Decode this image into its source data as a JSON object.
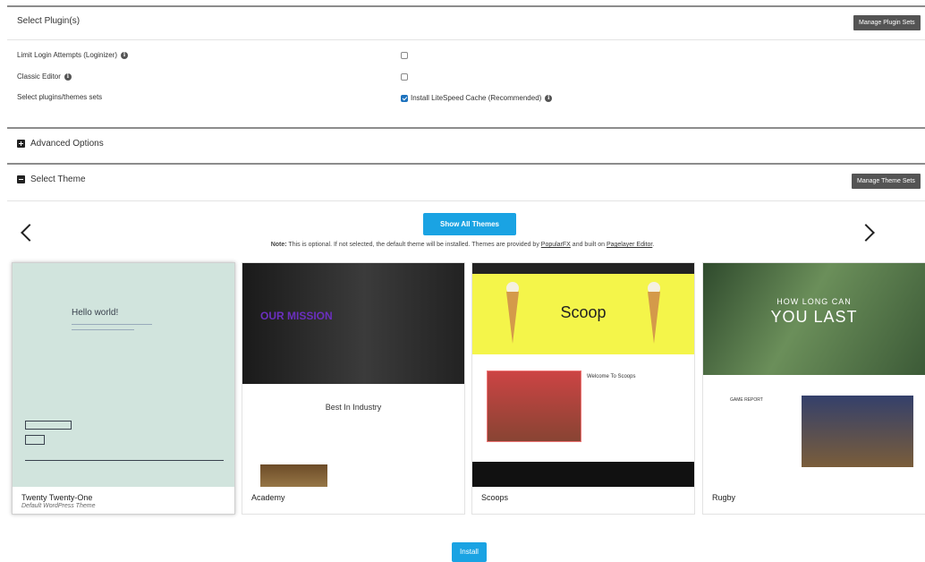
{
  "plugins_section": {
    "title": "Select Plugin(s)",
    "manage_button": "Manage Plugin Sets",
    "rows": [
      {
        "label": "Limit Login Attempts (Loginizer)",
        "has_info": true,
        "checked": false
      },
      {
        "label": "Classic Editor",
        "has_info": true,
        "checked": false
      },
      {
        "label": "Select plugins/themes sets",
        "has_info": false,
        "checked": true,
        "option_label": "Install LiteSpeed Cache (Recommended)"
      }
    ]
  },
  "advanced_section": {
    "title": "Advanced Options"
  },
  "theme_section": {
    "title": "Select Theme",
    "manage_button": "Manage Theme Sets",
    "show_all_button": "Show All Themes",
    "note_bold": "Note:",
    "note_text_1": " This is optional. If not selected, the default theme will be installed. Themes are provided by ",
    "note_link_1": "PopularFX",
    "note_text_2": " and built on ",
    "note_link_2": "Pagelayer Editor",
    "note_text_3": ".",
    "themes": [
      {
        "name": "Twenty Twenty-One",
        "subtitle": "Default WordPress Theme",
        "selected": true,
        "preview_heading": "Hello world!"
      },
      {
        "name": "Academy",
        "subtitle": "",
        "selected": false,
        "preview_heading": "OUR MISSION",
        "preview_sub": "Best In Industry"
      },
      {
        "name": "Scoops",
        "subtitle": "",
        "selected": false,
        "preview_heading": "Scoop",
        "preview_sub": "Welcome To Scoops"
      },
      {
        "name": "Rugby",
        "subtitle": "",
        "selected": false,
        "preview_heading": "YOU LAST",
        "preview_top": "HOW LONG CAN",
        "preview_sub": "GAME REPORT"
      }
    ]
  },
  "install_button": "Install",
  "colors": {
    "accent": "#1aa3e3",
    "dark_button": "#545454",
    "checkbox": "#1e73be"
  }
}
